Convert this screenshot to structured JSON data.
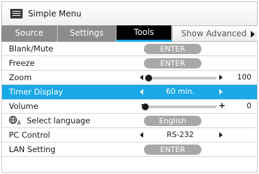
{
  "title": "Simple Menu",
  "tabs": [
    {
      "label": "Source"
    },
    {
      "label": "Settings"
    },
    {
      "label": "Tools"
    },
    {
      "label": "Show Advanced"
    }
  ],
  "menu": {
    "blank_mute": {
      "label": "Blank/Mute",
      "button": "ENTER"
    },
    "freeze": {
      "label": "Freeze",
      "button": "ENTER"
    },
    "zoom": {
      "label": "Zoom",
      "value": "100",
      "level": 0.05
    },
    "timer_display": {
      "label": "Timer Display",
      "value": "60 min."
    },
    "volume": {
      "label": "Volume",
      "value": "0",
      "level": 0.0
    },
    "select_language": {
      "label": "Select language",
      "value": "English"
    },
    "pc_control": {
      "label": "PC Control",
      "value": "RS-232"
    },
    "lan_setting": {
      "label": "LAN Setting",
      "button": "ENTER"
    }
  },
  "colors": {
    "selected_row": "#1aa8e6",
    "active_tab": "#000000",
    "active_tab_underline": "#19a6e6",
    "inactive_tab": "#8c8c8c",
    "button": "#a8a8a8"
  },
  "icons": {
    "title": "menu-list-icon",
    "language": "language-globe-icon",
    "advanced": "triangle-right-icon"
  }
}
